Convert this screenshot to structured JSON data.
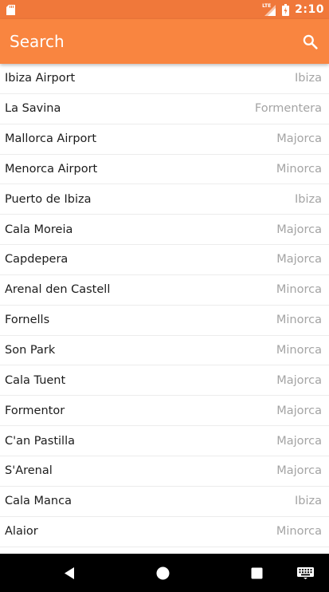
{
  "status_bar": {
    "time": "2:10",
    "network_label": "LTE",
    "icons": [
      "sd-card-icon",
      "signal-icon",
      "battery-icon"
    ]
  },
  "app_bar": {
    "title": "Search",
    "search_icon": "search-icon"
  },
  "list": {
    "items": [
      {
        "name": "Ibiza Airport",
        "region": "Ibiza"
      },
      {
        "name": "La Savina",
        "region": "Formentera"
      },
      {
        "name": "Mallorca Airport",
        "region": "Majorca"
      },
      {
        "name": "Menorca Airport",
        "region": "Minorca"
      },
      {
        "name": "Puerto de Ibiza",
        "region": "Ibiza"
      },
      {
        "name": "Cala Moreia",
        "region": "Majorca"
      },
      {
        "name": "Capdepera",
        "region": "Majorca"
      },
      {
        "name": "Arenal den Castell",
        "region": "Minorca"
      },
      {
        "name": "Fornells",
        "region": "Minorca"
      },
      {
        "name": "Son Park",
        "region": "Minorca"
      },
      {
        "name": "Cala Tuent",
        "region": "Majorca"
      },
      {
        "name": "Formentor",
        "region": "Majorca"
      },
      {
        "name": "C'an Pastilla",
        "region": "Majorca"
      },
      {
        "name": "S'Arenal",
        "region": "Majorca"
      },
      {
        "name": "Cala Manca",
        "region": "Ibiza"
      },
      {
        "name": "Alaior",
        "region": "Minorca"
      }
    ]
  },
  "nav_bar": {
    "icons": [
      "back-icon",
      "home-icon",
      "recents-icon",
      "keyboard-icon"
    ]
  },
  "colors": {
    "status_bar": "#f0783a",
    "app_bar": "#f98540",
    "primary_text": "#1c1c1c",
    "secondary_text": "#a4a4a4",
    "nav_bar": "#000000"
  }
}
